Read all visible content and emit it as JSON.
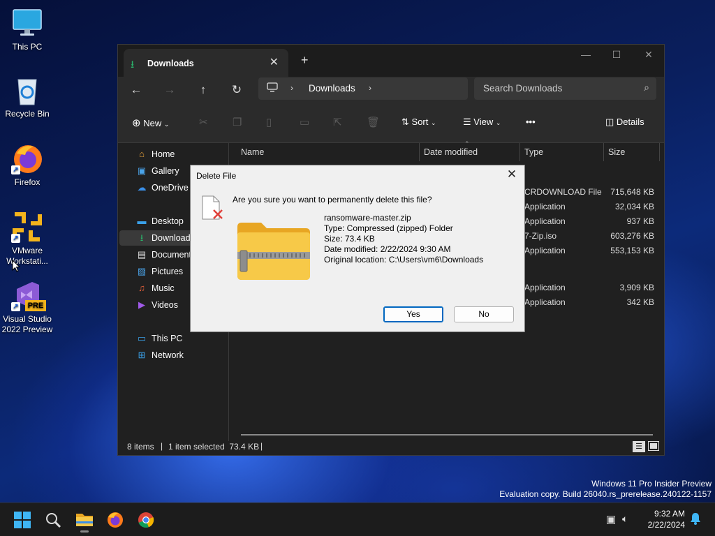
{
  "desktop": {
    "icons": [
      {
        "label": "This PC"
      },
      {
        "label": "Recycle Bin"
      },
      {
        "label": "Firefox"
      },
      {
        "label": "VMware Workstati..."
      },
      {
        "label": "Visual Studio 2022 Preview"
      }
    ],
    "vs_badge": "PRE",
    "watermark_line1": "Windows 11 Pro Insider Preview",
    "watermark_line2": "Evaluation copy. Build 26040.rs_prerelease.240122-1157"
  },
  "explorer": {
    "tab_title": "Downloads",
    "address": {
      "segment": "Downloads"
    },
    "search_placeholder": "Search Downloads",
    "toolbar": {
      "new_label": "New",
      "sort_label": "Sort",
      "view_label": "View",
      "more_label": "•••",
      "details_label": "Details"
    },
    "sidebar": [
      {
        "label": "Home"
      },
      {
        "label": "Gallery"
      },
      {
        "label": "OneDrive"
      },
      {
        "label": "Desktop"
      },
      {
        "label": "Downloads"
      },
      {
        "label": "Documents"
      },
      {
        "label": "Pictures"
      },
      {
        "label": "Music"
      },
      {
        "label": "Videos"
      },
      {
        "label": "This PC"
      },
      {
        "label": "Network"
      }
    ],
    "columns": {
      "name": "Name",
      "date": "Date modified",
      "type": "Type",
      "size": "Size"
    },
    "rows": [
      {
        "type": "CRDOWNLOAD File",
        "size": "715,648 KB"
      },
      {
        "type": "Application",
        "size": "32,034 KB"
      },
      {
        "type": "Application",
        "size": "937 KB"
      },
      {
        "type": "7-Zip.iso",
        "size": "603,276 KB"
      },
      {
        "type": "Application",
        "size": "553,153 KB"
      },
      {
        "type": "Application",
        "size": "3,909 KB"
      },
      {
        "type": "Application",
        "size": "342 KB"
      }
    ],
    "status": {
      "items": "8 items",
      "selected": "1 item selected  73.4 KB"
    }
  },
  "dialog": {
    "title": "Delete File",
    "question": "Are you sure you want to permanently delete this file?",
    "file_name": "ransomware-master.zip",
    "type_line": "Type: Compressed (zipped) Folder",
    "size_line": "Size: 73.4 KB",
    "date_line": "Date modified: 2/22/2024 9:30 AM",
    "location_line": "Original location: C:\\Users\\vm6\\Downloads",
    "yes_label": "Yes",
    "no_label": "No"
  },
  "taskbar": {
    "time": "9:32 AM",
    "date": "2/22/2024"
  },
  "colors": {
    "accent": "#0067c0",
    "downloads_green": "#2bb06a",
    "folder_yellow": "#f7c948"
  }
}
